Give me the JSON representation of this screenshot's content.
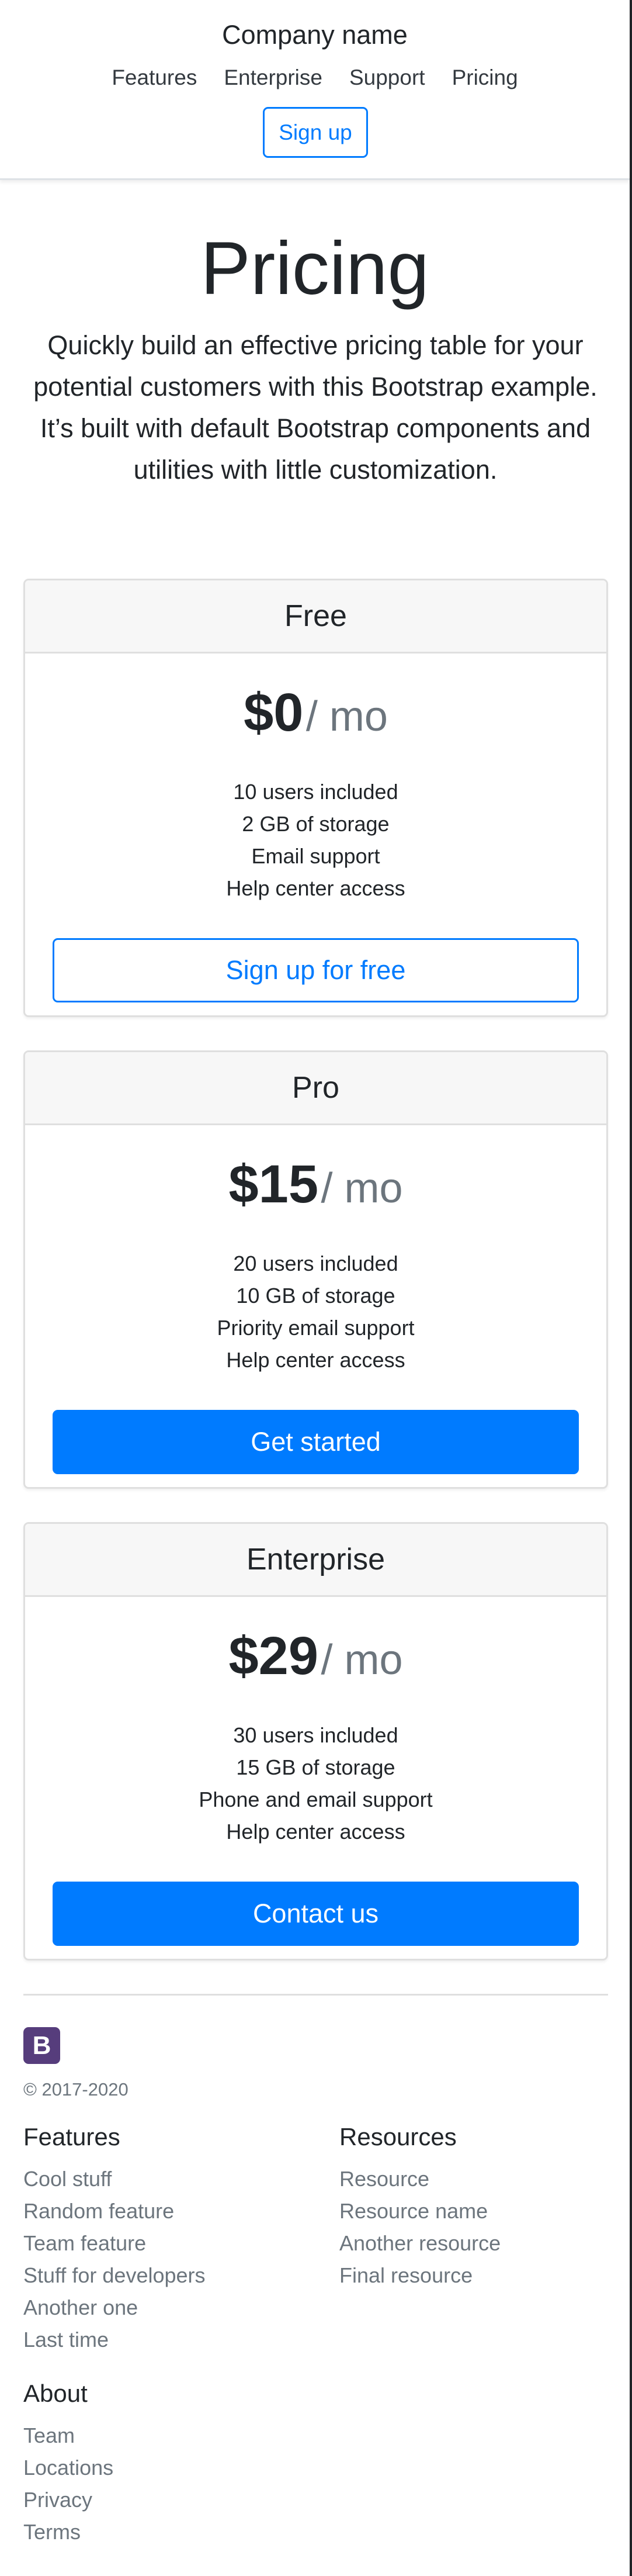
{
  "header": {
    "brand": "Company name",
    "nav": [
      "Features",
      "Enterprise",
      "Support",
      "Pricing"
    ],
    "signup_label": "Sign up"
  },
  "hero": {
    "title": "Pricing",
    "lead": "Quickly build an effective pricing table for your potential customers with this Bootstrap example. It’s built with default Bootstrap components and utilities with little customization."
  },
  "plans": [
    {
      "name": "Free",
      "price": "$0",
      "period": "/ mo",
      "features": [
        "10 users included",
        "2 GB of storage",
        "Email support",
        "Help center access"
      ],
      "button": "Sign up for free"
    },
    {
      "name": "Pro",
      "price": "$15",
      "period": "/ mo",
      "features": [
        "20 users included",
        "10 GB of storage",
        "Priority email support",
        "Help center access"
      ],
      "button": "Get started"
    },
    {
      "name": "Enterprise",
      "price": "$29",
      "period": "/ mo",
      "features": [
        "30 users included",
        "15 GB of storage",
        "Phone and email support",
        "Help center access"
      ],
      "button": "Contact us"
    }
  ],
  "footer": {
    "logo_letter": "B",
    "copyright": "© 2017-2020",
    "features": {
      "title": "Features",
      "items": [
        "Cool stuff",
        "Random feature",
        "Team feature",
        "Stuff for developers",
        "Another one",
        "Last time"
      ]
    },
    "resources": {
      "title": "Resources",
      "items": [
        "Resource",
        "Resource name",
        "Another resource",
        "Final resource"
      ]
    },
    "about": {
      "title": "About",
      "items": [
        "Team",
        "Locations",
        "Privacy",
        "Terms"
      ]
    }
  },
  "colors": {
    "primary": "#007bff",
    "logo": "#563d7c",
    "muted": "#6c757d"
  }
}
